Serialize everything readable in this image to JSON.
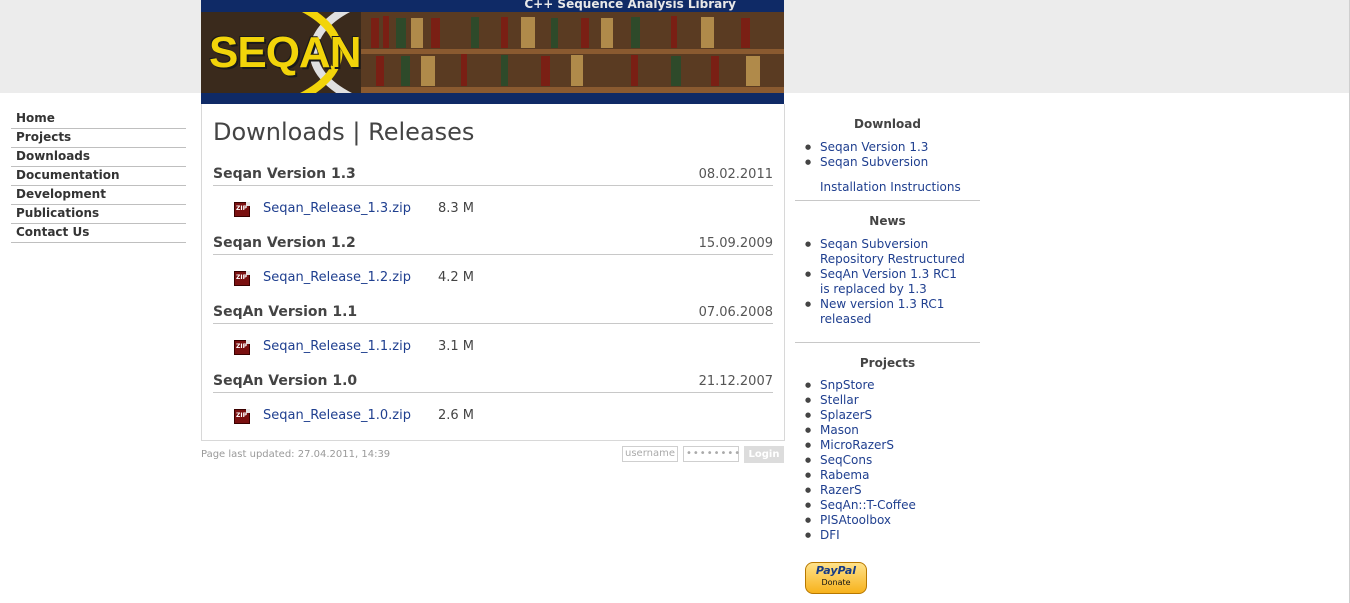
{
  "banner": {
    "tagline": "C++ Sequence Analysis Library",
    "logo_text": "SEQAN"
  },
  "nav": {
    "items": [
      "Home",
      "Projects",
      "Downloads",
      "Documentation",
      "Development",
      "Publications",
      "Contact Us"
    ]
  },
  "main": {
    "title": "Downloads | Releases",
    "releases": [
      {
        "title": "Seqan Version 1.3",
        "date": "08.02.2011",
        "file": "Seqan_Release_1.3.zip",
        "size": "8.3 M"
      },
      {
        "title": "Seqan Version 1.2",
        "date": "15.09.2009",
        "file": "Seqan_Release_1.2.zip",
        "size": "4.2 M"
      },
      {
        "title": "SeqAn Version 1.1",
        "date": "07.06.2008",
        "file": "Seqan_Release_1.1.zip",
        "size": "3.1 M"
      },
      {
        "title": "SeqAn Version 1.0",
        "date": "21.12.2007",
        "file": "Seqan_Release_1.0.zip",
        "size": "2.6 M"
      }
    ],
    "zip_icon_label": "ZIP"
  },
  "footer": {
    "updated": "Page last updated: 27.04.2011, 14:39",
    "username_placeholder": "username",
    "password_placeholder": "••••••••",
    "login_label": "Login"
  },
  "sidebar": {
    "download": {
      "heading": "Download",
      "items": [
        "Seqan Version 1.3",
        "Seqan Subversion"
      ],
      "extra": "Installation Instructions"
    },
    "news": {
      "heading": "News",
      "items": [
        "Seqan Subversion Repository Restructured",
        "SeqAn Version 1.3 RC1 is replaced by 1.3",
        "New version 1.3 RC1 released"
      ]
    },
    "projects": {
      "heading": "Projects",
      "items": [
        "SnpStore",
        "Stellar",
        "SplazerS",
        "Mason",
        "MicroRazerS",
        "SeqCons",
        "Rabema",
        "RazerS",
        "SeqAn::T-Coffee",
        "PISAtoolbox",
        "DFI"
      ]
    },
    "paypal": {
      "brand": "PayPal",
      "donate": "Donate"
    }
  },
  "colors": {
    "link": "#1f3f8f",
    "banner_blue": "#0f2a66",
    "logo_yellow": "#f2d40a"
  }
}
